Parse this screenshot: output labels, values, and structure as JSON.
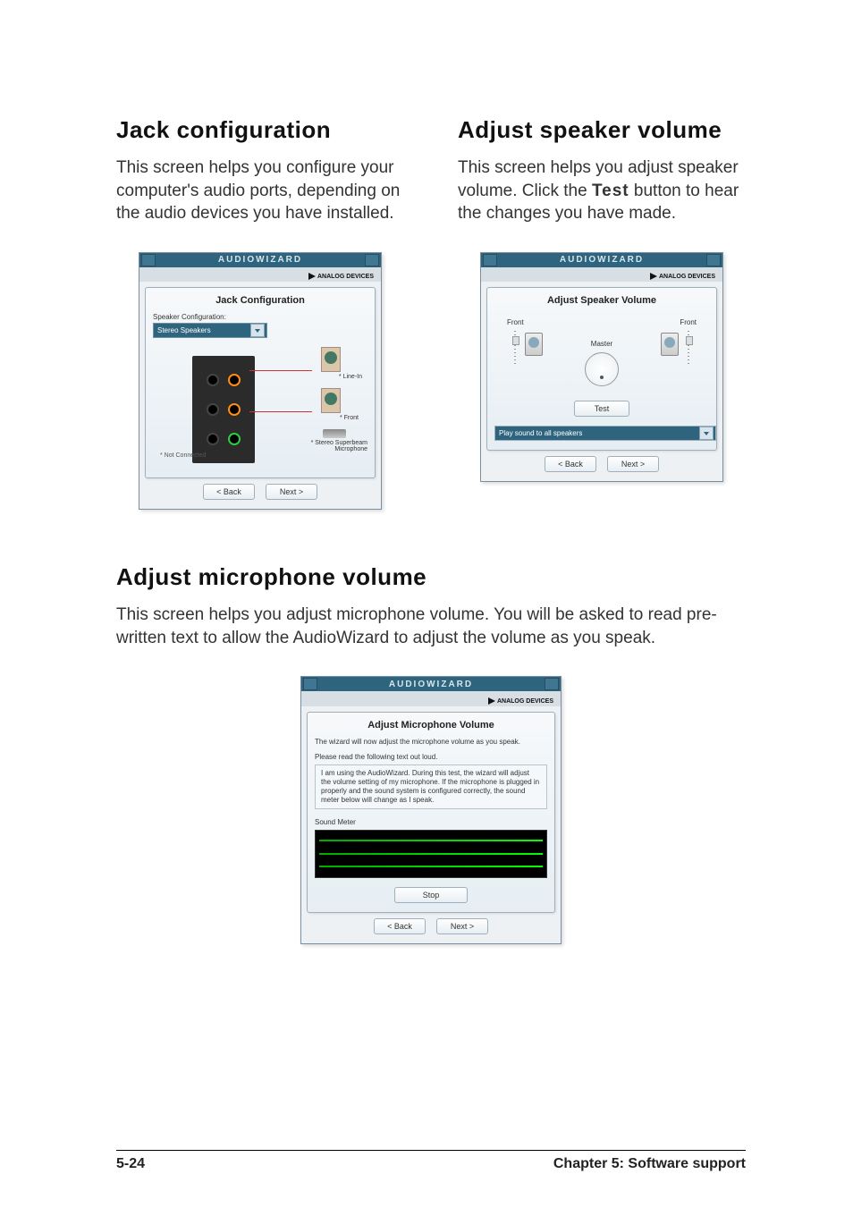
{
  "left": {
    "title": "Jack configuration",
    "body": "This screen helps you configure your computer's audio ports, depending on the audio devices you have installed.",
    "wiz": {
      "title": "AUDIOWIZARD",
      "brand": "ANALOG\nDEVICES",
      "card_title": "Jack Configuration",
      "field_label": "Speaker Configuration:",
      "dropdown_value": "Stereo Speakers",
      "label_linein": "* Line-In",
      "label_front": "* Front",
      "label_mic": "* Stereo Superbeam\nMicrophone",
      "not_connected": "* Not Connected",
      "back": "< Back",
      "next": "Next >",
      "back_ul": "B",
      "next_ul": "N"
    }
  },
  "right": {
    "title": "Adjust speaker volume",
    "body_pre": "This screen helps you adjust speaker volume. Click the ",
    "body_strong": "Test",
    "body_post": " button to hear the changes you have made.",
    "wiz": {
      "title": "AUDIOWIZARD",
      "brand": "ANALOG\nDEVICES",
      "card_title": "Adjust Speaker Volume",
      "front_left": "Front",
      "front_right": "Front",
      "master": "Master",
      "test": "Test",
      "test_ul": "T",
      "dropdown_value": "Play sound to all speakers",
      "back": "< Back",
      "next": "Next >",
      "back_ul": "B",
      "next_ul": "N"
    }
  },
  "mic": {
    "title": "Adjust microphone volume",
    "body": "This screen helps you adjust microphone volume. You will be asked to read pre-written text to allow the AudioWizard to adjust the volume as you speak.",
    "wiz": {
      "title": "AUDIOWIZARD",
      "brand": "ANALOG\nDEVICES",
      "card_title": "Adjust Microphone Volume",
      "intro": "The wizard will now adjust the microphone volume as you speak.",
      "instr": "Please read the following text out loud.",
      "read_text": "I am using the AudioWizard. During this test, the wizard will adjust the volume setting of my microphone. If the microphone is plugged in properly and the sound system is configured correctly, the sound meter below will change as I speak.",
      "sound_meter_label": "Sound Meter",
      "stop": "Stop",
      "stop_ul": "S",
      "back": "< Back",
      "next": "Next >",
      "back_ul": "B",
      "next_ul": "N"
    }
  },
  "footer": {
    "page": "5-24",
    "chapter": "Chapter 5: Software support"
  }
}
